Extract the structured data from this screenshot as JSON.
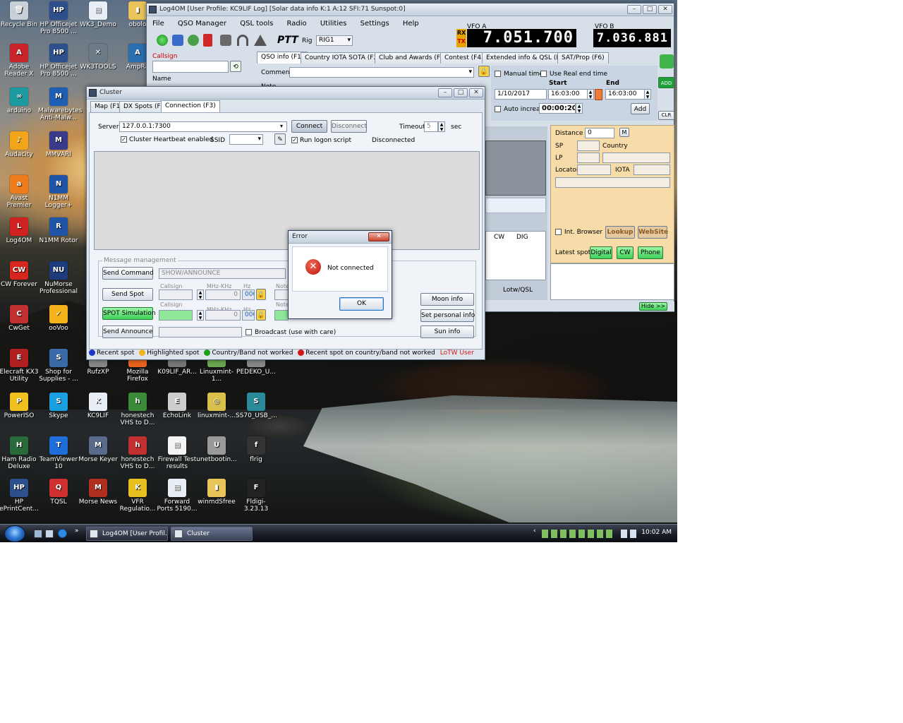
{
  "desktop": {
    "icons": [
      {
        "label": "Recycle Bin",
        "color": "#c8d0d8",
        "glyph": "🗑"
      },
      {
        "label": "HP Officejet Pro 8500 ...",
        "color": "#2d4f8c",
        "glyph": "HP"
      },
      {
        "label": "WK3_Demo",
        "color": "#e8eef5",
        "glyph": "▤"
      },
      {
        "label": "obolo",
        "color": "#e8c45a",
        "glyph": "▮"
      },
      {
        "label": "Adobe Reader X",
        "color": "#c8222a",
        "glyph": "A"
      },
      {
        "label": "HP Officejet Pro 8500 ...",
        "color": "#2d4f8c",
        "glyph": "HP"
      },
      {
        "label": "WK3TOOLS",
        "color": "#6c7a88",
        "glyph": "✕"
      },
      {
        "label": "AmpRa",
        "color": "#2a6fb0",
        "glyph": "A"
      },
      {
        "label": "arduino",
        "color": "#1c9aa0",
        "glyph": "∞"
      },
      {
        "label": "Malwarebytes Anti-Malw...",
        "color": "#1f5fb3",
        "glyph": "M"
      },
      {
        "label": "Audacity",
        "color": "#f2a51a",
        "glyph": "♪"
      },
      {
        "label": "MMVARI",
        "color": "#3a3a8a",
        "glyph": "M"
      },
      {
        "label": "Avast Premier",
        "color": "#f07b1a",
        "glyph": "a"
      },
      {
        "label": "N1MM Logger+",
        "color": "#2054a6",
        "glyph": "N"
      },
      {
        "label": "Log4OM",
        "color": "#d02020",
        "glyph": "L"
      },
      {
        "label": "N1MM Rotor",
        "color": "#2054a6",
        "glyph": "R"
      },
      {
        "label": "CW Forever",
        "color": "#d6261d",
        "glyph": "CW"
      },
      {
        "label": "NuMorse Professional",
        "color": "#1d3c7c",
        "glyph": "NU"
      },
      {
        "label": "CwGet",
        "color": "#c03030",
        "glyph": "C"
      },
      {
        "label": "ooVoo",
        "color": "#f5b21a",
        "glyph": "✓"
      },
      {
        "label": "Elecraft KX3 Utility",
        "color": "#b02020",
        "glyph": "E"
      },
      {
        "label": "Shop for Supplies - ...",
        "color": "#3a6aa8",
        "glyph": "S"
      },
      {
        "label": "RufzXP",
        "color": "#888888",
        "glyph": "R"
      },
      {
        "label": "Mozilla Firefox",
        "color": "#e8641e",
        "glyph": "F"
      },
      {
        "label": "K09LIF_AR...",
        "color": "#777777",
        "glyph": "K"
      },
      {
        "label": "Linuxmint-1...",
        "color": "#6aa84f",
        "glyph": "L"
      },
      {
        "label": "PEDEKO_U...",
        "color": "#888888",
        "glyph": "P"
      },
      {
        "label": "PowerISO",
        "color": "#f0c020",
        "glyph": "P"
      },
      {
        "label": "Skype",
        "color": "#1a9fe0",
        "glyph": "S"
      },
      {
        "label": "KC9LIF",
        "color": "#e8eef5",
        "glyph": "K"
      },
      {
        "label": "honestech VHS to D...",
        "color": "#3a8a3a",
        "glyph": "h"
      },
      {
        "label": "EchoLink",
        "color": "#cccccc",
        "glyph": "E"
      },
      {
        "label": "linuxmint-...",
        "color": "#d8c04a",
        "glyph": "◎"
      },
      {
        "label": "SS70_USB_...",
        "color": "#2a8a9a",
        "glyph": "S"
      },
      {
        "label": "Ham Radio Deluxe",
        "color": "#2a6a3a",
        "glyph": "H"
      },
      {
        "label": "TeamViewer 10",
        "color": "#1e6fd9",
        "glyph": "T"
      },
      {
        "label": "Morse Keyer",
        "color": "#5a6a8a",
        "glyph": "M"
      },
      {
        "label": "honestech VHS to D...",
        "color": "#c03030",
        "glyph": "h"
      },
      {
        "label": "Firewall Test results",
        "color": "#f4f4f4",
        "glyph": "▤"
      },
      {
        "label": "unetbootin...",
        "color": "#999999",
        "glyph": "U"
      },
      {
        "label": "flrig",
        "color": "#333333",
        "glyph": "f"
      },
      {
        "label": "HP ePrintCent...",
        "color": "#2d4f8c",
        "glyph": "HP"
      },
      {
        "label": "TQSL",
        "color": "#d03030",
        "glyph": "Q"
      },
      {
        "label": "Morse News",
        "color": "#b03020",
        "glyph": "M"
      },
      {
        "label": "VFR Regulatio...",
        "color": "#e8c020",
        "glyph": "K"
      },
      {
        "label": "Forward Ports 5190...",
        "color": "#e8eef5",
        "glyph": "▤"
      },
      {
        "label": "winmdSfree",
        "color": "#e8c45a",
        "glyph": "▮"
      },
      {
        "label": "Fldigi-3.23.13",
        "color": "#222222",
        "glyph": "F"
      }
    ]
  },
  "log4om": {
    "title": "Log4OM [User Profile: KC9LIF Log] [Solar data info K:1 A:12 SFI:71 Sunspot:0]",
    "menu": [
      "File",
      "QSO Manager",
      "QSL tools",
      "Radio",
      "Utilities",
      "Settings",
      "Help"
    ],
    "rig_label": "Rig",
    "rig_value": "RIG1",
    "ptt_label": "PTT",
    "vfo_a_label": "VFO A",
    "vfo_b_label": "VFO B",
    "vfo_a": "7.051.700",
    "vfo_b": "7.036.881",
    "rx_label": "RX",
    "tx_label": "TX",
    "callsign_label": "Callsign",
    "name_label": "Name",
    "tabs": [
      "QSO info (F1)",
      "Country IOTA SOTA (F2)",
      "Club and Awards (F3)",
      "Contest (F4)",
      "Extended info & QSL (F5)",
      "SAT/Prop (F6)"
    ],
    "comment_label": "Comment",
    "note_label": "Note",
    "manual_time_label": "Manual time",
    "use_real_end_time_label": "Use Real end time",
    "start_label": "Start",
    "end_label": "End",
    "date_value": "1/10/2017",
    "start_time": "16:03:00",
    "end_time": "16:03:00",
    "auto_increase_label": "Auto increase",
    "auto_increase_value": "00:00:20",
    "add_label": "Add",
    "add_green_label": "ADD",
    "clr_label": "CLR",
    "distance_label": "Distance",
    "distance_value": "0",
    "m_label": "M",
    "sp_label": "SP",
    "lp_label": "LP",
    "country_label": "Country",
    "locator_label": "Locator",
    "iota_label": "IOTA",
    "int_browser_label": "Int. Browser",
    "lookup_label": "Lookup",
    "website_label": "WebSite",
    "latest_spots_label": "Latest spots",
    "digital_label": "Digital",
    "cw_label": "CW",
    "phone_label": "Phone",
    "grid_headers": [
      "CW",
      "DIG"
    ],
    "lotw_qsl_label": "Lotw/QSL",
    "hide_label": "Hide >>"
  },
  "cluster": {
    "title": "Cluster",
    "tabs": [
      "Map (F1)",
      "DX Spots (F2)",
      "Connection (F3)"
    ],
    "server_label": "Server",
    "server_value": "127.0.0.1:7300",
    "connect_label": "Connect",
    "disconnect_label": "Disconnect",
    "timeout_label": "Timeout",
    "timeout_value": "5",
    "sec_label": "sec",
    "heartbeat_label": "Cluster Heartbeat enabled",
    "ssid_label": "SSID",
    "run_login_label": "Run logon script",
    "status_value": "Disconnected",
    "message_management_label": "Message management",
    "send_command_label": "Send Command",
    "command_value": "SHOW/ANNOUNCE",
    "send_spot_label": "Send Spot",
    "spot_simulation_label": "SPOT Simulation",
    "send_announce_label": "Send Announce",
    "callsign_label": "Callsign",
    "mhz_khz_label": "MHz-KHz",
    "hz_label": "Hz",
    "note_label": "Note",
    "freq_zero": "0",
    "freq_000": "000",
    "broadcast_label": "Broadcast (use with care)",
    "moon_info_label": "Moon info",
    "set_personal_info_label": "Set personal info",
    "sun_info_label": "Sun info",
    "legend": [
      {
        "label": "Recent spot",
        "color": "#1a35c8"
      },
      {
        "label": "Highlighted spot",
        "color": "#f2b21a"
      },
      {
        "label": "Country/Band not worked",
        "color": "#1aa01a"
      },
      {
        "label": "Recent spot on country/band not worked",
        "color": "#d01818"
      }
    ],
    "lotw_user_label": "LoTW User",
    "lotw_color": "#d01818"
  },
  "error_dialog": {
    "title": "Error",
    "message": "Not connected",
    "ok_label": "OK"
  },
  "taskbar": {
    "buttons": [
      "Log4OM [User Profil...",
      "Cluster"
    ],
    "clock": "10:02 AM"
  }
}
